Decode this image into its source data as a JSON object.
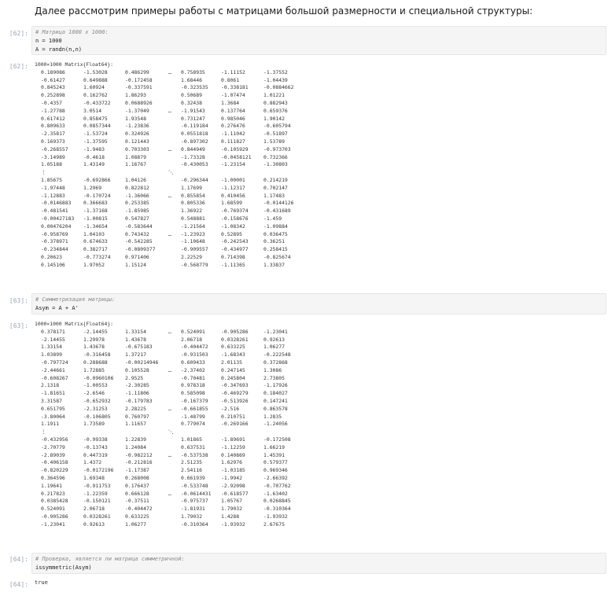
{
  "markdown": {
    "text": "Далее рассмотрим примеры работы с матрицами большой размерности и специальной структуры:"
  },
  "cells": [
    {
      "in_prompt": "[62]:",
      "input_lines": [
        {
          "type": "comment",
          "text": "# Матрица 1000 x 1000:"
        },
        {
          "type": "code",
          "text": "n = 1000"
        },
        {
          "type": "code",
          "text": "A = randn(n,n)"
        }
      ],
      "out_prompt": "[62]:",
      "output_header": "1000×1000 Matrix{Float64}:",
      "output_rows": [
        [
          "0.189086",
          "-1.53028",
          "0.486299",
          "…",
          "0.758935",
          "-1.11152",
          "-1.37552"
        ],
        [
          "-0.61427",
          "0.649888",
          "-0.172458",
          "",
          "1.68446",
          "0.8061",
          "-1.04439"
        ],
        [
          "0.845243",
          "1.60924",
          "-0.337591",
          "",
          "-0.323535",
          "-0.338181",
          "-0.0884662"
        ],
        [
          "0.252898",
          "0.162762",
          "1.86293",
          "",
          "0.50689",
          "-1.07474",
          "1.01221"
        ],
        [
          "-0.4357",
          "-0.433722",
          "0.0688926",
          "",
          "0.32438",
          "1.3684",
          "0.882943"
        ],
        [
          "-1.27788",
          "3.0514",
          "-1.37049",
          "…",
          "-1.91543",
          "0.137764",
          "0.659376"
        ],
        [
          "0.617412",
          "0.858475",
          "1.93548",
          "",
          "0.731247",
          "0.985046",
          "1.90142"
        ],
        [
          "0.809633",
          "0.0857344",
          "-1.23836",
          "",
          "-0.119184",
          "0.276476",
          "-0.605794"
        ],
        [
          "-2.35817",
          "-1.53724",
          "0.324926",
          "",
          "0.0551818",
          "-1.11042",
          "-0.51897"
        ],
        [
          "0.169373",
          "-1.37595",
          "0.121443",
          "",
          "-0.897302",
          "0.111827",
          "1.53789"
        ],
        [
          "-0.268557",
          "-1.9483",
          "0.703303",
          "…",
          "0.844949",
          "-0.105929",
          "-0.973703"
        ],
        [
          "-3.14989",
          "-0.4618",
          "1.08879",
          "",
          "-1.73328",
          "-0.0458121",
          "0.732366"
        ],
        [
          "1.05188",
          "1.43149",
          "1.16767",
          "",
          "-0.430053",
          "-1.23154",
          "-1.30803"
        ],
        [
          "⋮",
          "",
          "",
          "⋱",
          "",
          "",
          ""
        ],
        [
          "1.85675",
          "-0.692866",
          "1.04126",
          "",
          "-0.296344",
          "-1.00001",
          "0.214219"
        ],
        [
          "-1.97448",
          "1.2969",
          "0.822812",
          "",
          "1.17699",
          "-1.12317",
          "0.702147"
        ],
        [
          "-1.12883",
          "-0.170724",
          "-1.36066",
          "…",
          "0.855854",
          "0.410456",
          "1.17483"
        ],
        [
          "-0.0146883",
          "0.366683",
          "0.253385",
          "",
          "0.805336",
          "1.68599",
          "-0.0144126"
        ],
        [
          "-0.481541",
          "-1.37168",
          "-1.85985",
          "",
          "1.36922",
          "-0.769374",
          "-0.431689"
        ],
        [
          "-0.00427183",
          "-1.00815",
          "0.547827",
          "",
          "0.548881",
          "-0.158676",
          "-1.459"
        ],
        [
          "0.00476204",
          "-1.34654",
          "-0.583644",
          "",
          "-1.21564",
          "-1.08342",
          "-1.09884"
        ],
        [
          "-0.958769",
          "1.04103",
          "0.743432",
          "…",
          "-1.23923",
          "0.52895",
          "0.036475"
        ],
        [
          "-0.378971",
          "0.674633",
          "-0.542285",
          "",
          "-1.10648",
          "-0.242543",
          "0.36251"
        ],
        [
          "-0.234844",
          "0.382717",
          "-0.0809377",
          "",
          "-0.909557",
          "-0.434977",
          "0.258415"
        ],
        [
          "0.20623",
          "-0.773274",
          "0.971406",
          "",
          "2.22529",
          "0.714398",
          "-0.825674"
        ],
        [
          "0.145106",
          "1.97052",
          "1.15124",
          "",
          "-0.568779",
          "-1.11365",
          "1.33837"
        ]
      ]
    },
    {
      "in_prompt": "[63]:",
      "input_lines": [
        {
          "type": "comment",
          "text": "# Симметризация матрицы:"
        },
        {
          "type": "code",
          "text": "Asym = A + A'"
        }
      ],
      "out_prompt": "[63]:",
      "output_header": "1000×1000 Matrix{Float64}:",
      "output_rows": [
        [
          "0.378171",
          "-2.14455",
          "1.33154",
          "…",
          "0.524091",
          "-0.905286",
          "-1.23041"
        ],
        [
          "-2.14455",
          "1.29978",
          "1.43678",
          "",
          "2.06718",
          "0.0328261",
          "0.92613"
        ],
        [
          "1.33154",
          "1.43678",
          "-0.675183",
          "",
          "-0.404472",
          "0.633225",
          "1.06277"
        ],
        [
          "1.03899",
          "-0.316458",
          "1.37217",
          "",
          "-0.931503",
          "-1.68343",
          "-0.222548"
        ],
        [
          "-0.797724",
          "0.288688",
          "-0.00214946",
          "",
          "0.609433",
          "2.01135",
          "0.372868"
        ],
        [
          "-2.44661",
          "1.72885",
          "0.105528",
          "…",
          "-2.37402",
          "0.247145",
          "1.3086"
        ],
        [
          "-0.608267",
          "-0.0960106",
          "2.9525",
          "",
          "-0.70481",
          "0.245804",
          "2.73805"
        ],
        [
          "2.1318",
          "-1.00553",
          "-2.30285",
          "",
          "0.978318",
          "-0.347693",
          "-1.17926"
        ],
        [
          "-1.81651",
          "-2.6546",
          "-1.11806",
          "",
          "0.585098",
          "-0.469279",
          "0.184027"
        ],
        [
          "3.31587",
          "-0.652932",
          "-0.179783",
          "",
          "-0.167379",
          "-0.513926",
          "0.147241"
        ],
        [
          "0.651795",
          "-2.31253",
          "2.28225",
          "…",
          "-0.661855",
          "-2.516",
          "0.863578"
        ],
        [
          "-3.80064",
          "-0.106805",
          "0.760797",
          "",
          "-1.48799",
          "0.210751",
          "1.2835"
        ],
        [
          "1.1911",
          "1.73589",
          "1.11657",
          "",
          "0.779074",
          "-0.269166",
          "-1.24056"
        ],
        [
          "⋮",
          "",
          "",
          "⋱",
          "",
          "",
          ""
        ],
        [
          "-0.432956",
          "-0.99338",
          "1.22839",
          "",
          "1.01865",
          "-1.89691",
          "-0.172508"
        ],
        [
          "-2.70779",
          "-0.13743",
          "1.24084",
          "",
          "0.637531",
          "-1.12259",
          "1.66219"
        ],
        [
          "-2.89039",
          "0.447319",
          "-0.982212",
          "…",
          "-0.537538",
          "0.140869",
          "1.45391"
        ],
        [
          "-0.406158",
          "1.4372",
          "-0.212816",
          "",
          "2.51235",
          "1.62976",
          "0.579377"
        ],
        [
          "-0.820229",
          "-0.0172196",
          "-1.17387",
          "",
          "2.54116",
          "-1.03185",
          "0.969346"
        ],
        [
          "0.364596",
          "1.69348",
          "0.268008",
          "",
          "0.661939",
          "-1.9942",
          "-2.66392"
        ],
        [
          "1.19641",
          "-0.911753",
          "0.176437",
          "",
          "-0.533748",
          "-2.92098",
          "-0.707762"
        ],
        [
          "0.217823",
          "-1.22359",
          "0.666128",
          "…",
          "-0.0614431",
          "-0.618577",
          "-1.63402"
        ],
        [
          "0.0385428",
          "-0.150121",
          "-0.37511",
          "",
          "-0.975737",
          "1.05767",
          "0.0268845"
        ],
        [
          "0.524091",
          "2.06718",
          "-0.404472",
          "",
          "-1.81931",
          "1.79032",
          "-0.310364"
        ],
        [
          "-0.905286",
          "0.0328261",
          "0.633225",
          "",
          "1.79032",
          "1.4288",
          "-1.93932"
        ],
        [
          "-1.23041",
          "0.92613",
          "1.06277",
          "",
          "-0.310364",
          "-1.93932",
          "2.67675"
        ]
      ]
    },
    {
      "in_prompt": "[64]:",
      "input_lines": [
        {
          "type": "comment",
          "text": "# Проверка, является ли матрица симметричной:"
        },
        {
          "type": "code",
          "text": "issymmetric(Asym)"
        }
      ],
      "out_prompt": "[64]:",
      "output_header": "true",
      "output_rows": []
    }
  ]
}
